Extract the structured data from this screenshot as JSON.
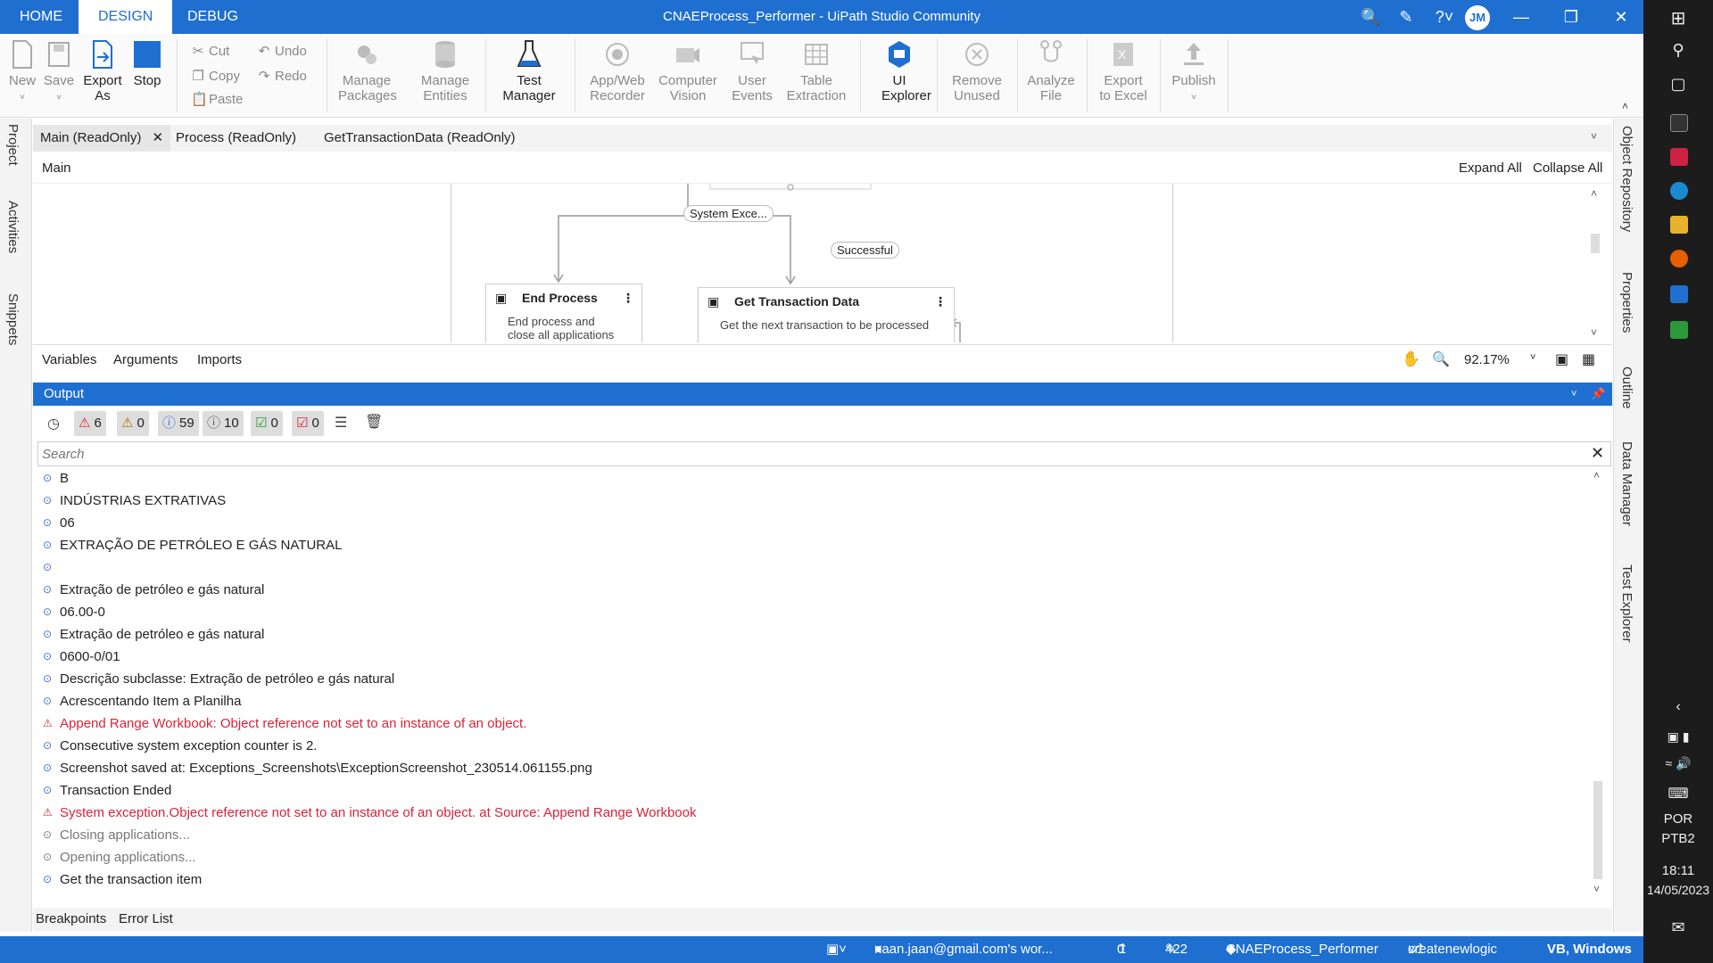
{
  "menu": {
    "tabs": [
      "HOME",
      "DESIGN",
      "DEBUG"
    ],
    "active_tab": "DESIGN",
    "window_title": "CNAEProcess_Performer - UiPath Studio Community",
    "avatar_initials": "JM"
  },
  "ribbon": {
    "new": "New",
    "save": "Save",
    "export_as": "Export As",
    "stop": "Stop",
    "cut": "Cut",
    "copy": "Copy",
    "paste": "Paste",
    "undo": "Undo",
    "redo": "Redo",
    "manage_packages": "Manage Packages",
    "manage_entities": "Manage Entities",
    "test_manager": "Test Manager",
    "app_web_recorder": "App/Web Recorder",
    "computer_vision": "Computer Vision",
    "user_events": "User Events",
    "table_extraction": "Table Extraction",
    "ui_explorer": "UI Explorer",
    "remove_unused": "Remove Unused",
    "analyze_file": "Analyze File",
    "export_to_excel": "Export to Excel",
    "publish": "Publish"
  },
  "left_panels": [
    "Project",
    "Activities",
    "Snippets"
  ],
  "right_panels": [
    "Object Repository",
    "Properties",
    "Outline",
    "Data Manager",
    "Test Explorer"
  ],
  "doc_tabs": [
    "Main (ReadOnly)",
    "Process (ReadOnly)",
    "GetTransactionData (ReadOnly)"
  ],
  "breadcrumb": "Main",
  "designer": {
    "expand_all": "Expand All",
    "collapse_all": "Collapse All",
    "edge_labels": {
      "system_exception": "System Exce...",
      "successful": "Successful"
    },
    "nodes": {
      "end_process": {
        "title": "End Process",
        "desc": "End process and close all applications"
      },
      "get_transaction": {
        "title": "Get Transaction Data",
        "desc": "Get the next transaction to be processed"
      }
    },
    "bottom_tabs": [
      "Variables",
      "Arguments",
      "Imports"
    ],
    "zoom": "92.17%"
  },
  "output": {
    "title": "Output",
    "filters": {
      "errors": "6",
      "warnings": "0",
      "info": "59",
      "trace": "10",
      "success": "0",
      "failed": "0"
    },
    "search_placeholder": "Search",
    "lines": [
      {
        "level": "info",
        "text": "B"
      },
      {
        "level": "info",
        "text": "INDÚSTRIAS EXTRATIVAS"
      },
      {
        "level": "info",
        "text": "06"
      },
      {
        "level": "info",
        "text": "EXTRAÇÃO DE PETRÓLEO E GÁS NATURAL"
      },
      {
        "level": "info",
        "text": ""
      },
      {
        "level": "info",
        "text": "Extração de petróleo e gás natural"
      },
      {
        "level": "info",
        "text": "06.00-0"
      },
      {
        "level": "info",
        "text": "Extração de petróleo e gás natural"
      },
      {
        "level": "info",
        "text": "0600-0/01"
      },
      {
        "level": "info",
        "text": "Descrição subclasse:  Extração de petróleo e gás natural"
      },
      {
        "level": "info",
        "text": "Acrescentando Item a Planilha"
      },
      {
        "level": "warn",
        "text": "Append Range Workbook: Object reference not set to an instance of an object."
      },
      {
        "level": "info",
        "text": "Consecutive system exception counter is 2."
      },
      {
        "level": "info",
        "text": "Screenshot saved at: Exceptions_Screenshots\\ExceptionScreenshot_230514.061155.png"
      },
      {
        "level": "info",
        "text": "Transaction Ended"
      },
      {
        "level": "warn",
        "text": "System exception.Object reference not set to an instance of an object. at Source: Append Range Workbook"
      },
      {
        "level": "trace",
        "text": "Closing applications..."
      },
      {
        "level": "trace",
        "text": "Opening applications..."
      },
      {
        "level": "info",
        "text": "Get the transaction item"
      }
    ]
  },
  "bottom_tabs": [
    "Breakpoints",
    "Error List"
  ],
  "statusbar": {
    "orchestrator": "naan.jaan@gmail.com's wor...",
    "publish_count": "0",
    "changes_count": "422",
    "project": "CNAEProcess_Performer",
    "branch": "createnewlogic",
    "language": "VB, Windows"
  },
  "taskbar": {
    "lang1": "POR",
    "lang2": "PTB2",
    "time": "18:11",
    "date": "14/05/2023"
  },
  "colors": {
    "accent": "#1f6fd1",
    "error": "#d9233a",
    "info": "#3a6fd8"
  }
}
